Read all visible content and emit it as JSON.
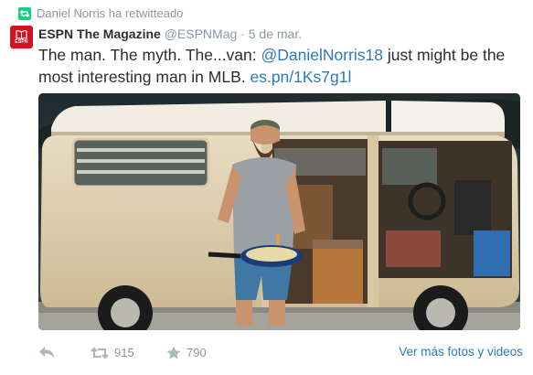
{
  "retweet_context": {
    "text": "Daniel Norris ha retwitteado"
  },
  "author": {
    "avatar_label": "ESPN",
    "name": "ESPN The Magazine",
    "handle": "@ESPNMag",
    "separator": "·",
    "date": "5 de mar."
  },
  "tweet": {
    "text_before": "The man. The myth. The...van: ",
    "mention": "@DanielNorris18",
    "text_after": " just might be the most interesting man in MLB. ",
    "link": "es.pn/1Ks7g1l"
  },
  "media": {
    "icon": "photo-of-man-cooking-in-van"
  },
  "actions": {
    "reply_icon": "reply-icon",
    "retweet_icon": "retweet-icon",
    "retweet_count": "915",
    "favorite_icon": "star-icon",
    "favorite_count": "790",
    "more_link": "Ver más fotos y videos"
  },
  "colors": {
    "link": "#2b7bb9",
    "muted": "#8899a6",
    "retweet_green": "#19cf86",
    "espn_red": "#d1121f"
  }
}
